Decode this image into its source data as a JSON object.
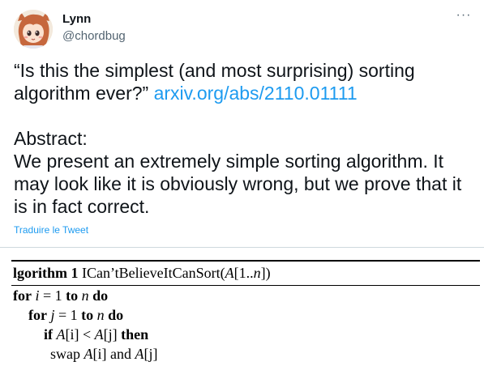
{
  "author": {
    "name": "Lynn",
    "handle": "@chordbug",
    "avatar_icon": "anime-girl-avatar-icon"
  },
  "more_icon": "more-options-icon",
  "more_label": "···",
  "tweet": {
    "quote": "“Is this the simplest (and most surprising) sorting algorithm ever?”",
    "link": "arxiv.org/abs/2110.01111",
    "abstract_heading": "Abstract:",
    "abstract_text": "We present an extremely simple sorting algorithm. It may look like it is obviously wrong, but we prove that it is in fact correct.",
    "translate_label": "Traduire le Tweet"
  },
  "media": {
    "algorithm": {
      "label": "lgorithm 1",
      "name": "ICan’tBelieveItCanSort",
      "arg_open": "(",
      "arg_var": "A",
      "arg_range": "[1..",
      "arg_n": "n",
      "arg_close": "])",
      "lines": {
        "l1_kw_for": "for",
        "l1_var": "i",
        "l1_eq": " = 1 ",
        "l1_kw_to": "to",
        "l1_n": "n",
        "l1_kw_do": "do",
        "l2_kw_for": "for",
        "l2_var": "j",
        "l2_eq": " = 1 ",
        "l2_kw_to": "to",
        "l2_n": "n",
        "l2_kw_do": "do",
        "l3_kw_if": "if",
        "l3_cond_a": "A",
        "l3_cond_ai": "[i]",
        "l3_lt": " < ",
        "l3_cond_b": "A",
        "l3_cond_bj": "[j]",
        "l3_kw_then": "then",
        "l4_swap": "swap",
        "l4_a": "A",
        "l4_ai": "[i]",
        "l4_and": " and ",
        "l4_b": "A",
        "l4_bj": "[j]"
      }
    }
  },
  "colors": {
    "link": "#1d9bf0",
    "text": "#0f1419",
    "secondary": "#536471"
  }
}
